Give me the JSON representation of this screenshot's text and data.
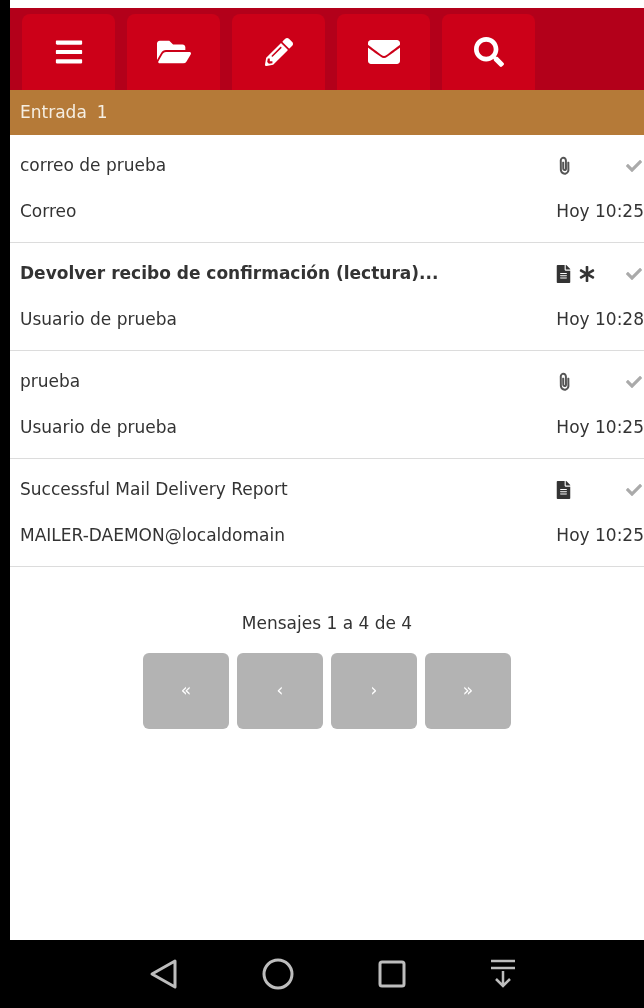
{
  "toolbar": [
    {
      "kind": "menu"
    },
    {
      "kind": "folder"
    },
    {
      "kind": "compose"
    },
    {
      "kind": "mail"
    },
    {
      "kind": "search"
    }
  ],
  "folder": {
    "name": "Entrada",
    "count": "1"
  },
  "messages": [
    {
      "subject": "correo de prueba",
      "from": "Correo",
      "date": "Hoy 10:25",
      "unread": false,
      "kind": "attachment",
      "flagged": false
    },
    {
      "subject": "Devolver recibo de confirmación (lectura)...",
      "from": "Usuario de prueba",
      "date": "Hoy 10:28",
      "unread": true,
      "kind": "document",
      "flagged": true
    },
    {
      "subject": "prueba",
      "from": "Usuario de prueba",
      "date": "Hoy 10:25",
      "unread": false,
      "kind": "attachment",
      "flagged": false
    },
    {
      "subject": "Successful Mail Delivery Report",
      "from": "MAILER-DAEMON@localdomain",
      "date": "Hoy 10:25",
      "unread": false,
      "kind": "document",
      "flagged": false
    }
  ],
  "pager": {
    "summary": "Mensajes 1 a 4 de 4",
    "buttons": [
      "«",
      "‹",
      "›",
      "»"
    ]
  },
  "navbar": [
    {
      "kind": "back"
    },
    {
      "kind": "home"
    },
    {
      "kind": "recents"
    },
    {
      "kind": "dropdown"
    }
  ]
}
